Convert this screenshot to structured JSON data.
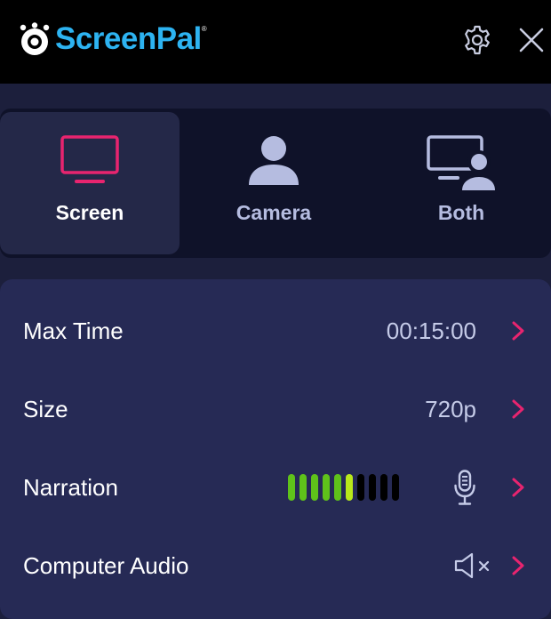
{
  "app": {
    "brand": "ScreenPal",
    "brand_mark": "®",
    "colors": {
      "brand": "#2db3f1",
      "accent": "#e8246f",
      "meter_on": "#5fc21a",
      "meter_peak": "#b9e81b",
      "meter_off": "#000000"
    }
  },
  "header": {
    "settings_icon": "gear-icon",
    "close_icon": "close-icon"
  },
  "modes": [
    {
      "label": "Screen",
      "icon": "monitor-icon",
      "active": true
    },
    {
      "label": "Camera",
      "icon": "person-icon",
      "active": false
    },
    {
      "label": "Both",
      "icon": "monitor-person-icon",
      "active": false
    }
  ],
  "settings": {
    "max_time": {
      "label": "Max Time",
      "value": "00:15:00"
    },
    "size": {
      "label": "Size",
      "value": "720p"
    },
    "narration": {
      "label": "Narration",
      "level_bars_total": 10,
      "level_bars_lit": 6,
      "icon": "microphone-icon"
    },
    "computer_audio": {
      "label": "Computer Audio",
      "muted": true,
      "icon": "speaker-muted-icon"
    }
  }
}
